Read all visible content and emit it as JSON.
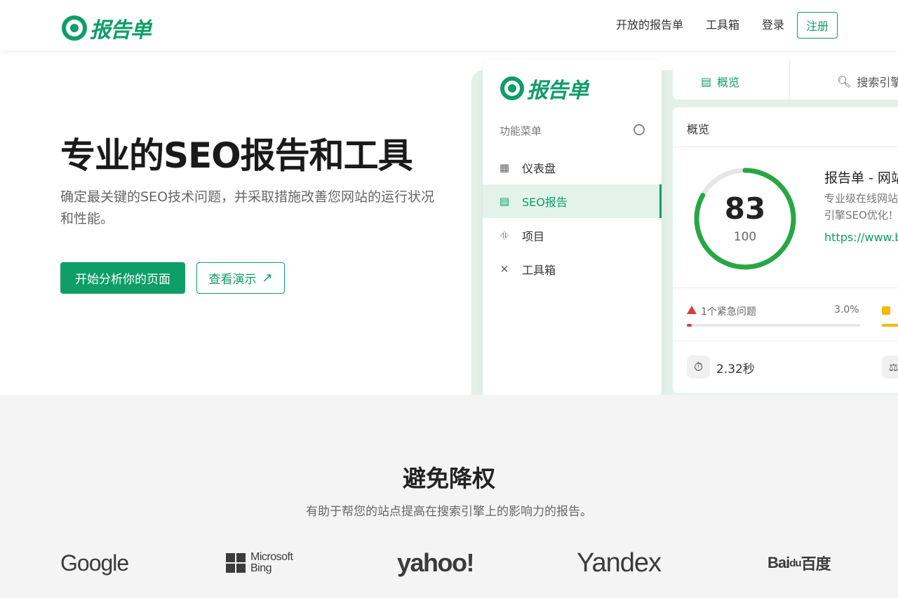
{
  "brand": {
    "name": "报告单",
    "color": "#0f9d68"
  },
  "nav": {
    "items": [
      "开放的报告单",
      "工具箱",
      "登录"
    ],
    "register": "注册"
  },
  "hero": {
    "title": "专业的SEO报告和工具",
    "subtitle": "确定最关键的SEO技术问题，并采取措施改善您网站的运行状况和性能。",
    "primary_button": "开始分析你的页面",
    "secondary_button": "查看演示",
    "secondary_icon": "arrow-up-right-icon"
  },
  "mockup": {
    "logo_text": "报告单",
    "menu_title": "功能菜单",
    "menu": [
      {
        "label": "仪表盘",
        "icon": "grid-icon",
        "active": false
      },
      {
        "label": "SEO报告",
        "icon": "report-icon",
        "active": true
      },
      {
        "label": "项目",
        "icon": "project-icon",
        "active": false
      },
      {
        "label": "工具箱",
        "icon": "tools-icon",
        "active": false
      }
    ],
    "tabs": [
      {
        "label": "概览",
        "icon": "report-icon"
      },
      {
        "label": "搜索引擎",
        "icon": "search-icon"
      }
    ],
    "card_title": "概览",
    "score": {
      "value": 83,
      "max": 100
    },
    "site_title": "报告单 - 网站",
    "site_desc_line1": "专业级在线网站",
    "site_desc_line2": "引擎SEO优化！",
    "site_url": "https://www.b",
    "issue": {
      "label": "1个紧急问题",
      "percent": "3.0%",
      "fraction": 0.03
    },
    "load_time": "2.32秒"
  },
  "section2": {
    "title": "避免降权",
    "subtitle": "有助于帮您的站点提高在搜索引擎上的影响力的报告。",
    "engines": {
      "google": "Google",
      "bing_line1": "Microsoft",
      "bing_line2": "Bing",
      "yahoo": "yahoo!",
      "yandex": "Yandex",
      "baidu_latin": "Bai",
      "baidu_du": "du",
      "baidu_cn": "百度"
    }
  }
}
